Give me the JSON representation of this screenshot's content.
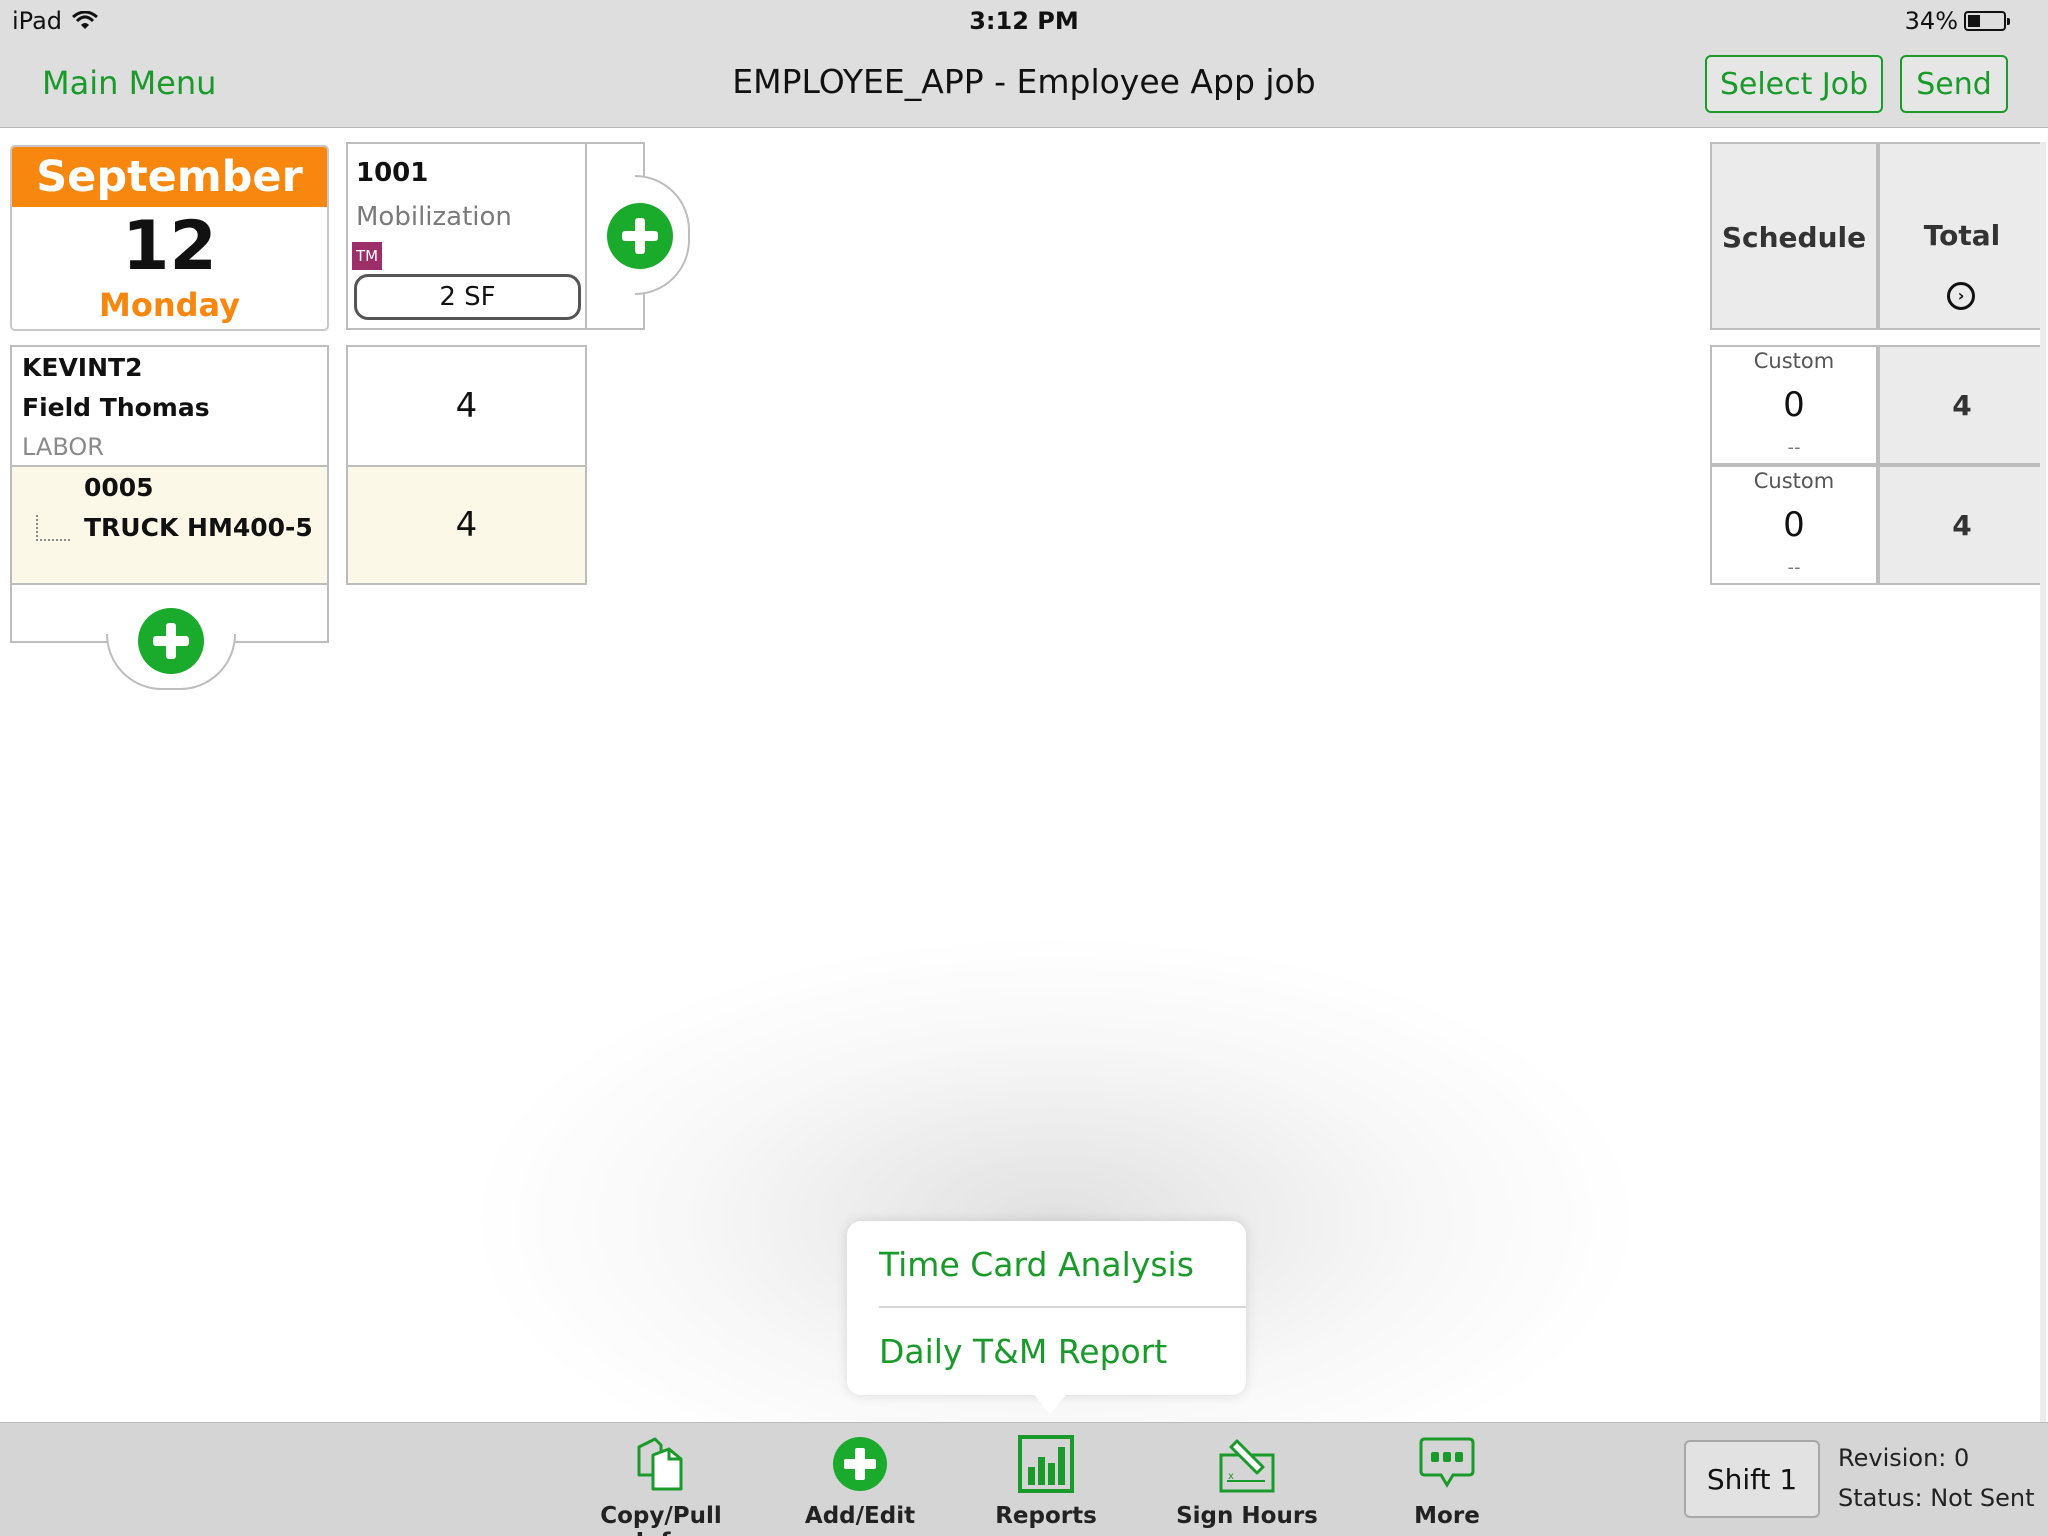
{
  "status_bar": {
    "device": "iPad",
    "time": "3:12 PM",
    "battery": "34%"
  },
  "nav": {
    "main_menu": "Main Menu",
    "title": "EMPLOYEE_APP - Employee App job",
    "select_job": "Select Job",
    "send": "Send"
  },
  "date": {
    "month": "September",
    "day": "12",
    "weekday": "Monday"
  },
  "cost_code": {
    "number": "1001",
    "description": "Mobilization",
    "badge": "TM",
    "quantity": "2 SF"
  },
  "rows": [
    {
      "id": "KEVINT2",
      "name": "Field Thomas",
      "class": "LABOR",
      "hours": "4",
      "schedule_label": "Custom",
      "schedule_value": "0",
      "schedule_sub": "--",
      "total": "4"
    },
    {
      "id": "0005",
      "name": "TRUCK HM400-5",
      "hours": "4",
      "schedule_label": "Custom",
      "schedule_value": "0",
      "schedule_sub": "--",
      "total": "4"
    }
  ],
  "summary": {
    "schedule": "Schedule",
    "total": "Total"
  },
  "reports_menu": {
    "items": [
      "Time Card Analysis",
      "Daily T&M Report"
    ]
  },
  "toolbar": {
    "copy": "Copy/Pull Info",
    "add": "Add/Edit",
    "reports": "Reports",
    "sign": "Sign Hours",
    "more": "More",
    "shift": "Shift 1",
    "revision": "Revision: 0",
    "status": "Status: Not Sent"
  },
  "colors": {
    "accent_green": "#1a9a2a",
    "date_orange": "#f7870e",
    "tm_badge": "#9c2f6a",
    "equipment_row_bg": "#fcf8e8"
  }
}
